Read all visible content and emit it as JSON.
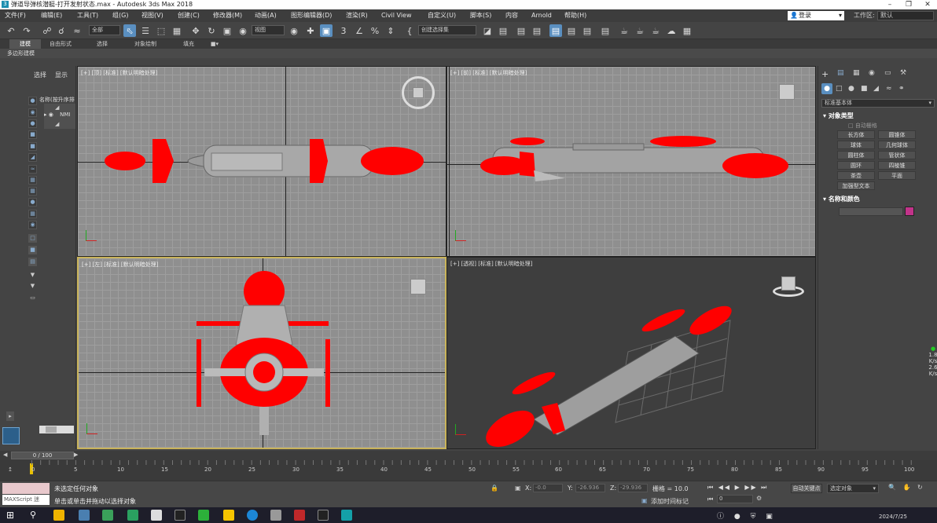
{
  "window": {
    "title": "弹道导弹核潜艇-打开发射状态.max - Autodesk 3ds Max 2018",
    "app_icon": "3"
  },
  "menu": [
    "文件(F)",
    "编辑(E)",
    "工具(T)",
    "组(G)",
    "视图(V)",
    "创建(C)",
    "修改器(M)",
    "动画(A)",
    "图形编辑器(D)",
    "渲染(R)",
    "Civil View",
    "自定义(U)",
    "脚本(S)",
    "内容",
    "Arnold",
    "帮助(H)"
  ],
  "login": "登录",
  "workspace": {
    "label": "工作区:",
    "value": "默认"
  },
  "toolbar": {
    "filter_all": "全部",
    "ref_coord": "视图",
    "selection_set": "创建选择集"
  },
  "ribbon": {
    "tabs": [
      "建模",
      "自由形式",
      "选择",
      "对象绘制",
      "填充"
    ],
    "active_tab": "建模",
    "sub_label": "多边形建模"
  },
  "explorer": {
    "tabs": [
      "选择",
      "显示"
    ],
    "header": "名称(按升序排",
    "rows": [
      "NMI"
    ]
  },
  "viewports": {
    "top": "[+] [顶] [标准] [默认明暗处理]",
    "front": "[+] [前] [标准] [默认明暗处理]",
    "left": "[+] [左] [标准] [默认明暗处理]",
    "persp": "[+] [透视] [标准] [默认明暗处理]"
  },
  "command_panel": {
    "dropdown": "标准基本体",
    "object_type_title": "对象类型",
    "autogrid": "自动栅格",
    "buttons": [
      "长方体",
      "圆锥体",
      "球体",
      "几何球体",
      "圆柱体",
      "管状体",
      "圆环",
      "四棱锥",
      "茶壶",
      "平面",
      "加强型文本"
    ],
    "name_color_title": "名称和颜色",
    "swatch_color": "#c2338a"
  },
  "timeline": {
    "range": "0 / 100",
    "ticks": [
      "0",
      "5",
      "10",
      "15",
      "20",
      "25",
      "30",
      "35",
      "40",
      "45",
      "50",
      "55",
      "60",
      "65",
      "70",
      "75",
      "80",
      "85",
      "90",
      "95",
      "100"
    ]
  },
  "status": {
    "maxscript": "MAXScript 迷",
    "line1": "未选定任何对象",
    "line2": "单击或单击并拖动以选择对象",
    "x_label": "X:",
    "y_label": "Y:",
    "z_label": "Z:",
    "x_val": "-0.0",
    "y_val": "-26.936",
    "z_val": "-29.936",
    "grid": "栅格 = 10.0",
    "add_time_tag": "添加时间标记",
    "auto_key": "自动关键点",
    "selected_obj": "选定对象",
    "frame": "0"
  },
  "side_stats": {
    "up": "1.8",
    "down": "2.6",
    "unit": "K/s"
  },
  "taskbar": {
    "clock": "2024/7/25"
  }
}
